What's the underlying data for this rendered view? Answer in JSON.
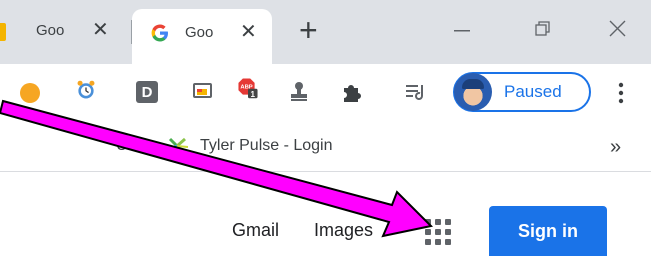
{
  "tabs": [
    {
      "title": "Goo",
      "favicon": "bookmark-favicon",
      "active": false
    },
    {
      "title": "Goo",
      "favicon": "google-icon",
      "active": true
    }
  ],
  "window_controls": [
    "minimize-icon",
    "restore-icon",
    "close-icon"
  ],
  "extensions": [
    "orange-circle-extension",
    "alarm-clock-extension",
    "d-extension",
    "screencast-extension",
    "adblock-extension",
    "stamp-extension",
    "puzzle-extensions-icon",
    "reading-list-icon"
  ],
  "adblock_badge": "1",
  "adblock_text": "ABP",
  "d_extension_letter": "D",
  "profile": {
    "status": "Paused"
  },
  "bookmarks": {
    "partial_label": "U",
    "items": [
      {
        "label": "Tyler Pulse - Login",
        "icon": "pinwheel-icon"
      }
    ],
    "more": "»"
  },
  "page": {
    "links": {
      "gmail": "Gmail",
      "images": "Images"
    },
    "sign_in": "Sign in"
  },
  "colors": {
    "accent": "#1a73e8",
    "arrow": "#ff00ff"
  }
}
